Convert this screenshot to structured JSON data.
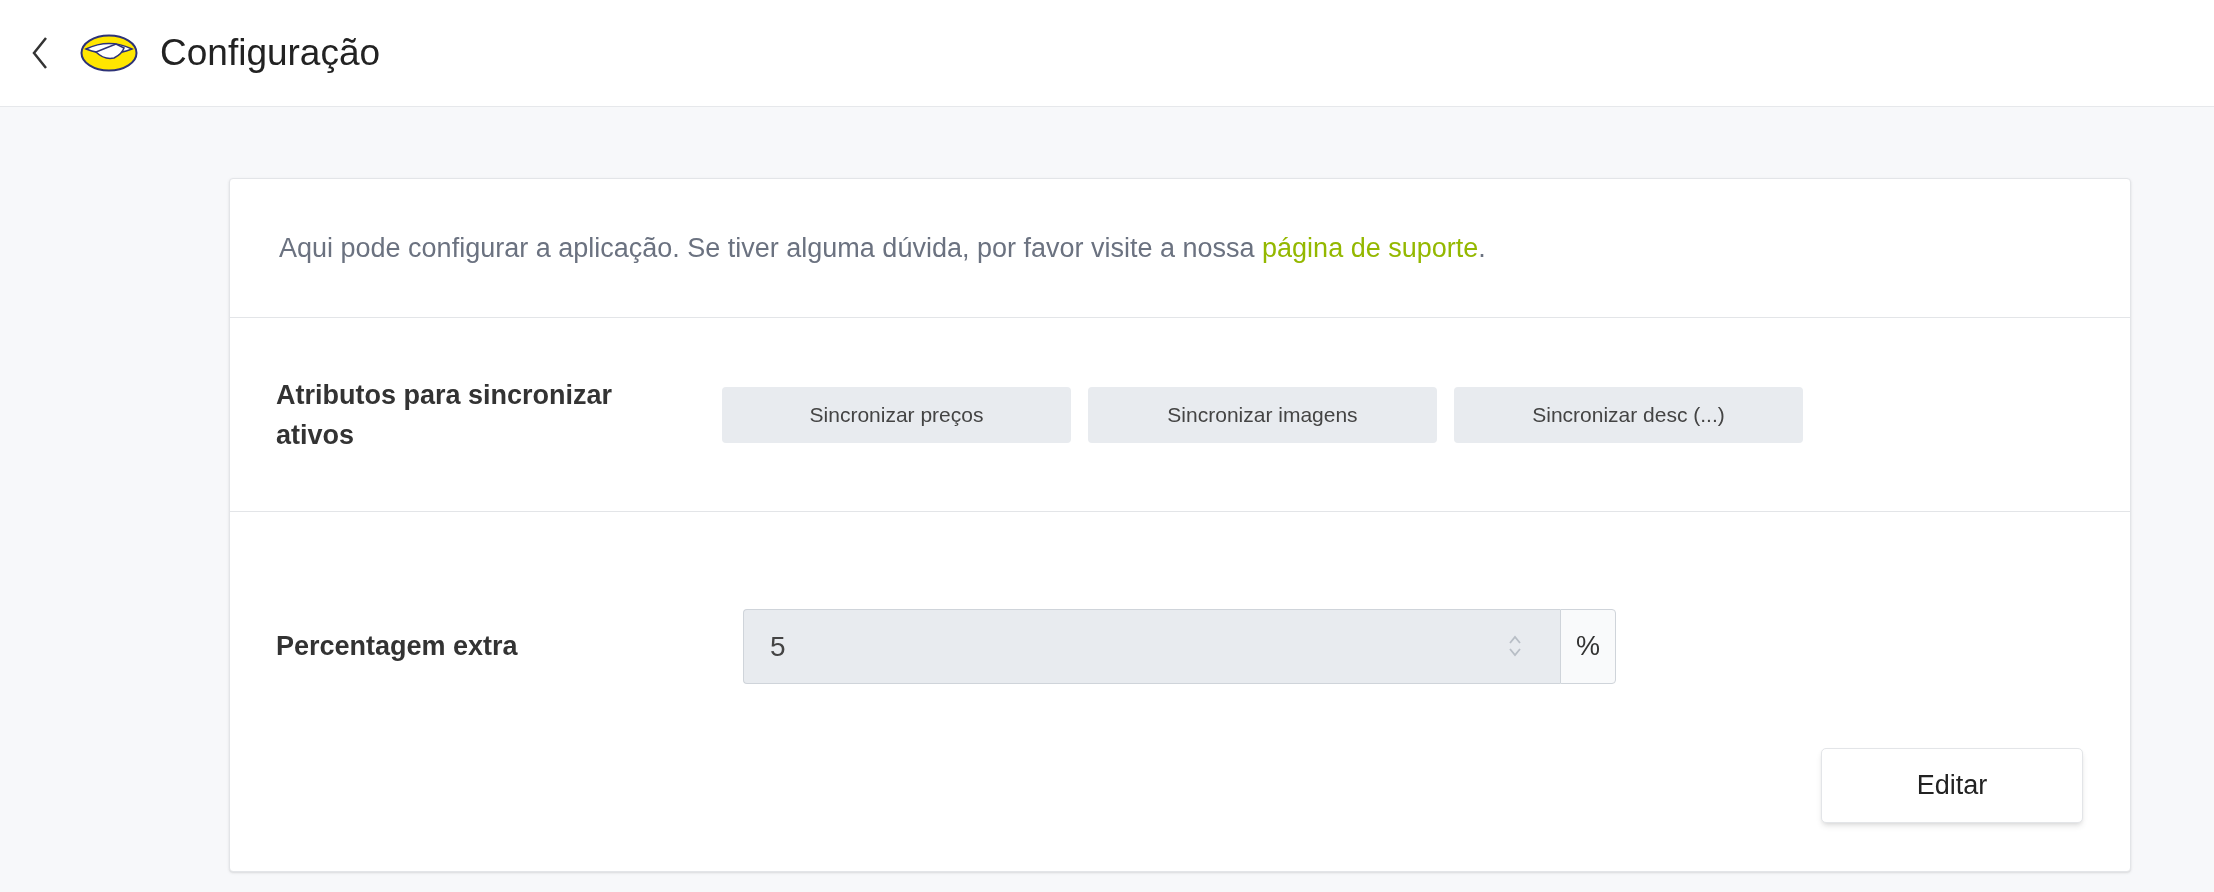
{
  "header": {
    "title": "Configuração"
  },
  "intro": {
    "text": "Aqui pode configurar a aplicação. Se tiver alguma dúvida, por favor visite a nossa ",
    "link": "página de suporte",
    "end": "."
  },
  "sync": {
    "label": "Atributos para sincronizar ativos",
    "buttons": [
      "Sincronizar preços",
      "Sincronizar imagens",
      "Sincronizar desc (...)"
    ]
  },
  "extra": {
    "label": "Percentagem extra",
    "value": "5",
    "unit": "%",
    "disabled": true
  },
  "edit_button": "Editar"
}
